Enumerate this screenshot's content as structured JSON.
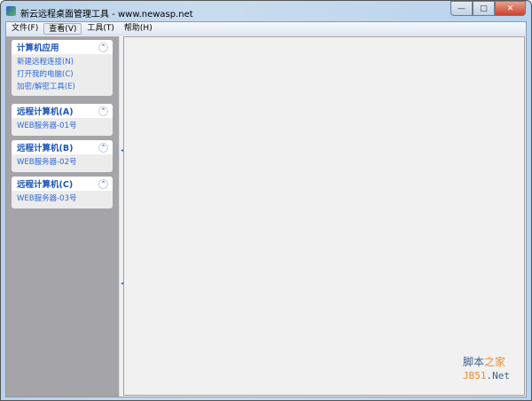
{
  "window": {
    "title": "新云远程桌面管理工具 - www.newasp.net",
    "minimize": "—",
    "maximize": "□",
    "close": "✕"
  },
  "menu": [
    "文件(F)",
    "查看(V)",
    "工具(T)",
    "帮助(H)"
  ],
  "panels": [
    {
      "title": "计算机应用",
      "items": [
        "新建远程连接(N)",
        "打开我的电脑(C)",
        "加密/解密工具(E)"
      ]
    },
    {
      "title": "远程计算机(A)",
      "items": [
        "WEB服务器-01号"
      ]
    },
    {
      "title": "远程计算机(B)",
      "items": [
        "WEB服务器-02号"
      ]
    },
    {
      "title": "远程计算机(C)",
      "items": [
        "WEB服务器-03号"
      ]
    }
  ],
  "collapse_glyph": "⌃",
  "watermark": {
    "line1a": "脚本",
    "line1b": "之家",
    "line2a": "JB51",
    "line2b": ".Net"
  }
}
